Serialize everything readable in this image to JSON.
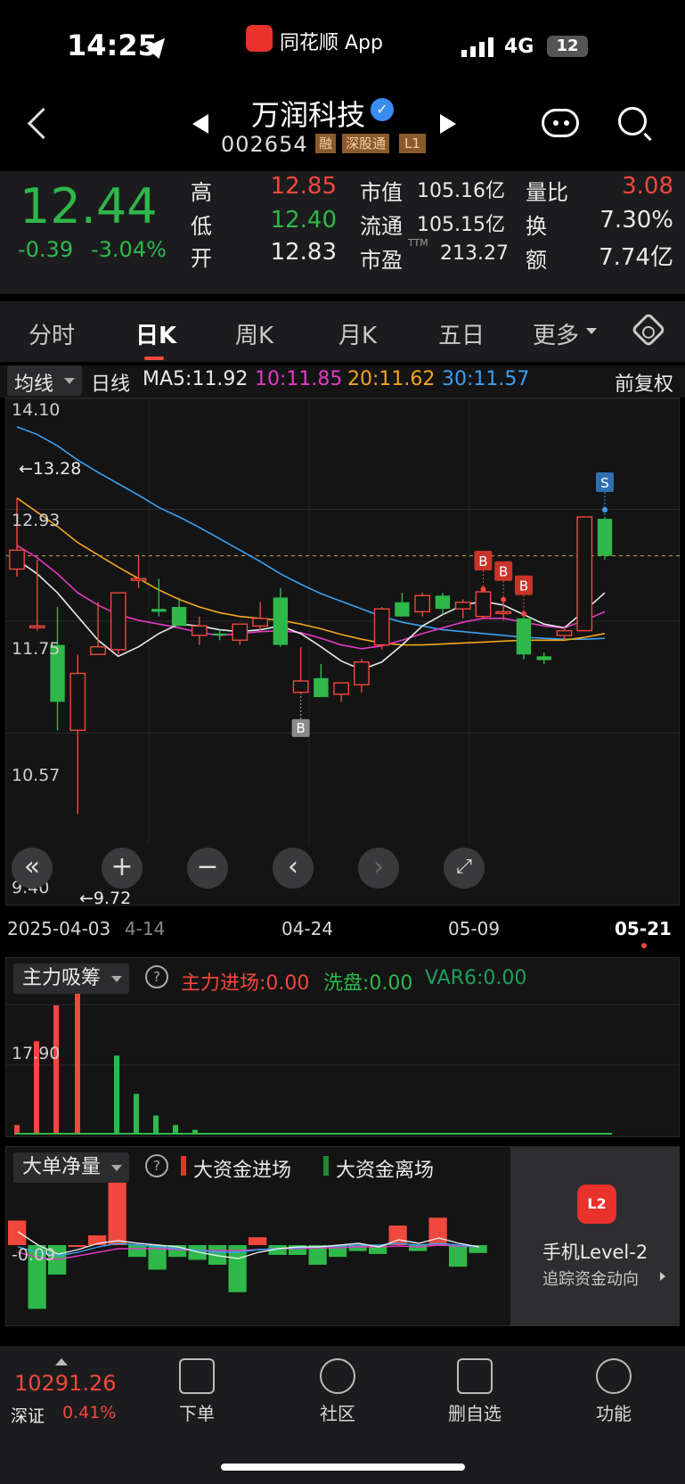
{
  "status": {
    "time": "14:25",
    "app_name": "同花顺 App",
    "network": "4G",
    "battery": "12"
  },
  "header": {
    "title": "万润科技",
    "code": "002654",
    "tags": [
      "融",
      "深股通",
      "L1"
    ]
  },
  "quote": {
    "price": "12.44",
    "change": "-0.39",
    "change_pct": "-3.04%",
    "high_label": "高",
    "high": "12.85",
    "low_label": "低",
    "low": "12.40",
    "open_label": "开",
    "open": "12.83",
    "mcap_label": "市值",
    "mcap": "105.16亿",
    "float_label": "流通",
    "float_val": "105.15亿",
    "pe_label": "市盈",
    "pe_sup": "TTM",
    "pe": "213.27",
    "vr_label": "量比",
    "vr": "3.08",
    "turn_label": "换",
    "turn": "7.30%",
    "amt_label": "额",
    "amt": "7.74亿"
  },
  "tabs": [
    "分时",
    "日K",
    "周K",
    "月K",
    "五日",
    "更多"
  ],
  "active_tab": "日K",
  "ma_row": {
    "dropdown": "均线",
    "period": "日线",
    "ma5": "MA5:11.92",
    "ma10": "10:11.85",
    "ma20": "20:11.62",
    "ma30": "30:11.57",
    "adjust": "前复权"
  },
  "kline": {
    "y_labels": [
      "14.10",
      "12.93",
      "11.75",
      "10.57",
      "9.40"
    ],
    "max_marker": "←13.28",
    "min_marker": "←9.72",
    "x_labels": [
      "2025-04-03",
      "4-14",
      "04-24",
      "05-09",
      "05-21"
    ],
    "signal_b": "B",
    "signal_s": "S"
  },
  "chart_data": {
    "type": "candlestick",
    "ylim": [
      9.4,
      14.1
    ],
    "candles": [
      {
        "o": 12.3,
        "h": 13.05,
        "l": 12.22,
        "c": 12.5
      },
      {
        "o": 11.7,
        "h": 12.4,
        "l": 11.65,
        "c": 11.7
      },
      {
        "o": 11.5,
        "h": 11.9,
        "l": 10.6,
        "c": 10.9
      },
      {
        "o": 10.6,
        "h": 11.4,
        "l": 9.72,
        "c": 11.2
      },
      {
        "o": 11.4,
        "h": 11.95,
        "l": 11.4,
        "c": 11.48
      },
      {
        "o": 11.45,
        "h": 12.05,
        "l": 11.4,
        "c": 12.05
      },
      {
        "o": 12.2,
        "h": 12.45,
        "l": 12.1,
        "c": 12.2
      },
      {
        "o": 11.88,
        "h": 12.2,
        "l": 11.8,
        "c": 11.85
      },
      {
        "o": 11.9,
        "h": 12.0,
        "l": 11.7,
        "c": 11.7
      },
      {
        "o": 11.6,
        "h": 11.8,
        "l": 11.5,
        "c": 11.7
      },
      {
        "o": 11.62,
        "h": 11.66,
        "l": 11.55,
        "c": 11.6
      },
      {
        "o": 11.55,
        "h": 11.72,
        "l": 11.5,
        "c": 11.72
      },
      {
        "o": 11.7,
        "h": 11.95,
        "l": 11.65,
        "c": 11.78
      },
      {
        "o": 12.0,
        "h": 12.1,
        "l": 11.48,
        "c": 11.5
      },
      {
        "o": 11.0,
        "h": 11.48,
        "l": 10.98,
        "c": 11.12
      },
      {
        "o": 11.15,
        "h": 11.3,
        "l": 10.95,
        "c": 10.95
      },
      {
        "o": 10.98,
        "h": 11.1,
        "l": 10.9,
        "c": 11.1
      },
      {
        "o": 11.08,
        "h": 11.35,
        "l": 11.0,
        "c": 11.32
      },
      {
        "o": 11.5,
        "h": 11.9,
        "l": 11.45,
        "c": 11.88
      },
      {
        "o": 11.95,
        "h": 12.05,
        "l": 11.8,
        "c": 11.8
      },
      {
        "o": 11.85,
        "h": 12.05,
        "l": 11.8,
        "c": 12.02
      },
      {
        "o": 12.02,
        "h": 12.05,
        "l": 11.82,
        "c": 11.88
      },
      {
        "o": 11.88,
        "h": 11.98,
        "l": 11.78,
        "c": 11.95
      },
      {
        "o": 11.8,
        "h": 12.06,
        "l": 11.78,
        "c": 12.06
      },
      {
        "o": 11.85,
        "h": 11.95,
        "l": 11.76,
        "c": 11.85
      },
      {
        "o": 11.78,
        "h": 11.8,
        "l": 11.35,
        "c": 11.4
      },
      {
        "o": 11.38,
        "h": 11.42,
        "l": 11.3,
        "c": 11.34
      },
      {
        "o": 11.6,
        "h": 11.7,
        "l": 11.55,
        "c": 11.65
      },
      {
        "o": 11.65,
        "h": 12.85,
        "l": 11.65,
        "c": 12.85
      },
      {
        "o": 12.83,
        "h": 12.85,
        "l": 12.4,
        "c": 12.44
      }
    ],
    "ma5": [
      12.4,
      12.25,
      12.05,
      11.8,
      11.55,
      11.38,
      11.48,
      11.62,
      11.72,
      11.7,
      11.66,
      11.64,
      11.66,
      11.7,
      11.62,
      11.48,
      11.33,
      11.24,
      11.32,
      11.5,
      11.7,
      11.82,
      11.92,
      11.96,
      11.92,
      11.82,
      11.72,
      11.68,
      11.86,
      12.05
    ],
    "ma10": [
      12.55,
      12.42,
      12.25,
      12.05,
      11.92,
      11.82,
      11.76,
      11.72,
      11.68,
      11.63,
      11.6,
      11.62,
      11.64,
      11.65,
      11.63,
      11.57,
      11.5,
      11.46,
      11.49,
      11.55,
      11.62,
      11.68,
      11.74,
      11.78,
      11.78,
      11.74,
      11.7,
      11.68,
      11.76,
      11.85
    ],
    "ma20": [
      13.05,
      12.9,
      12.75,
      12.58,
      12.45,
      12.32,
      12.2,
      12.08,
      11.98,
      11.9,
      11.84,
      11.8,
      11.78,
      11.76,
      11.72,
      11.67,
      11.61,
      11.56,
      11.52,
      11.5,
      11.5,
      11.51,
      11.52,
      11.53,
      11.54,
      11.55,
      11.55,
      11.55,
      11.58,
      11.62
    ],
    "ma30": [
      13.8,
      13.72,
      13.6,
      13.45,
      13.32,
      13.2,
      13.08,
      12.95,
      12.85,
      12.74,
      12.62,
      12.5,
      12.38,
      12.25,
      12.14,
      12.04,
      11.96,
      11.88,
      11.8,
      11.74,
      11.7,
      11.66,
      11.64,
      11.62,
      11.6,
      11.58,
      11.57,
      11.56,
      11.56,
      11.57
    ],
    "b_signals": [
      14,
      23,
      24,
      25
    ],
    "s_signal": 29,
    "zlxc_bars": [
      0.8,
      7.8,
      10.8,
      13.2,
      0,
      6.6,
      3.4,
      1.6,
      0.8,
      0.4
    ],
    "ddjl": [
      2.5,
      -6.5,
      -3.0,
      0,
      1.0,
      6.5,
      -1.2,
      -2.5,
      -1.2,
      -1.5,
      -2.0,
      -4.8,
      0.8,
      -1.0,
      -1.0,
      -2.0,
      -1.2,
      -0.6,
      -0.9,
      2.0,
      -0.6,
      2.8,
      -2.2,
      -0.8
    ]
  },
  "zlxc": {
    "dropdown": "主力吸筹",
    "help": "?",
    "in": "主力进场:0.00",
    "wash": "洗盘:0.00",
    "var6": "VAR6:0.00",
    "y_label": "17.90"
  },
  "ddjl": {
    "dropdown": "大单净量",
    "help": "?",
    "legend_in": "大资金进场",
    "legend_out": "大资金离场",
    "y_label": "-0.09",
    "promo_title": "手机Level-2",
    "promo_sub": "追踪资金动向",
    "promo_badge": "L2"
  },
  "bottom": {
    "index_value": "10291.26",
    "index_name": "深证",
    "index_pct": "0.41%",
    "nav": [
      "下单",
      "社区",
      "删自选",
      "功能"
    ]
  }
}
